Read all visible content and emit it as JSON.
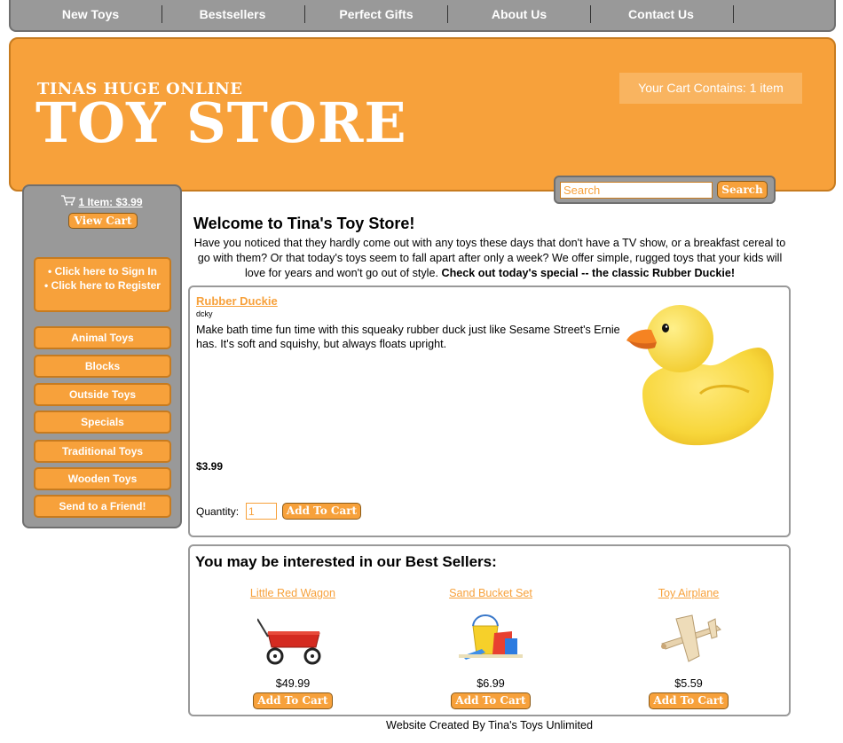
{
  "nav": {
    "items": [
      "New Toys",
      "Bestsellers",
      "Perfect Gifts",
      "About Us",
      "Contact Us"
    ]
  },
  "header": {
    "logo_small": "TINAS HUGE ONLINE",
    "logo_big": "TOY STORE",
    "cart_status": "Your Cart Contains: 1 item"
  },
  "search": {
    "placeholder": "Search",
    "button_label": "Search"
  },
  "sidebar": {
    "cart_summary": "1 Item: $3.99",
    "view_cart_label": "View Cart",
    "sign_in": "• Click here to Sign In",
    "register": "• Click here to Register",
    "menu": [
      "Animal Toys",
      "Blocks",
      "Outside Toys",
      "Specials",
      "Traditional Toys",
      "Wooden Toys",
      "Send to a Friend!"
    ]
  },
  "welcome": {
    "title": "Welcome to Tina's Toy Store!",
    "text": "Have you noticed that they hardly come out with any toys these days that don't have a TV show, or a breakfast cereal to go with them? Or that today's toys seem to fall apart after only a week? We offer simple, rugged toys that your kids will love for years and won't go out of style.",
    "text_bold": "Check out today's special -- the classic Rubber Duckie!"
  },
  "product": {
    "name": "Rubber Duckie",
    "sku": "dcky",
    "description": "Make bath time fun time with this squeaky rubber duck just like Sesame Street's Ernie has. It's soft and squishy, but always floats upright.",
    "price": "$3.99",
    "quantity_label": "Quantity:",
    "quantity_value": "1",
    "add_label": "Add To Cart"
  },
  "bestsellers": {
    "title": "You may be interested in our Best Sellers:",
    "items": [
      {
        "name": "Little Red Wagon",
        "price": "$49.99",
        "add_label": "Add To Cart"
      },
      {
        "name": "Sand Bucket Set",
        "price": "$6.99",
        "add_label": "Add To Cart"
      },
      {
        "name": "Toy Airplane",
        "price": "$5.59",
        "add_label": "Add To Cart"
      }
    ]
  },
  "footer": {
    "text": "Website Created By Tina's Toys Unlimited"
  },
  "colors": {
    "accent": "#f7a13b",
    "gray_panel": "#999999"
  }
}
